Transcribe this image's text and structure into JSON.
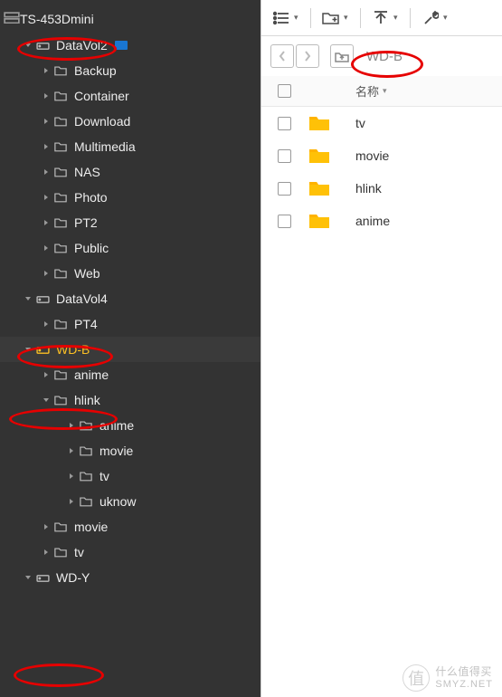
{
  "root": {
    "label": "TS-453Dmini"
  },
  "tree": [
    {
      "type": "drive",
      "label": "DataVol2",
      "depth": 1,
      "expanded": true,
      "selected": false,
      "badge": true
    },
    {
      "type": "folder",
      "label": "Backup",
      "depth": 2,
      "expanded": false
    },
    {
      "type": "folder",
      "label": "Container",
      "depth": 2,
      "expanded": false
    },
    {
      "type": "folder",
      "label": "Download",
      "depth": 2,
      "expanded": false
    },
    {
      "type": "folder",
      "label": "Multimedia",
      "depth": 2,
      "expanded": false
    },
    {
      "type": "folder",
      "label": "NAS",
      "depth": 2,
      "expanded": false
    },
    {
      "type": "folder",
      "label": "Photo",
      "depth": 2,
      "expanded": false
    },
    {
      "type": "folder",
      "label": "PT2",
      "depth": 2,
      "expanded": false
    },
    {
      "type": "folder",
      "label": "Public",
      "depth": 2,
      "expanded": false
    },
    {
      "type": "folder",
      "label": "Web",
      "depth": 2,
      "expanded": false
    },
    {
      "type": "drive",
      "label": "DataVol4",
      "depth": 1,
      "expanded": true,
      "selected": false
    },
    {
      "type": "folder",
      "label": "PT4",
      "depth": 2,
      "expanded": false
    },
    {
      "type": "drive",
      "label": "WD-B",
      "depth": 1,
      "expanded": true,
      "selected": true
    },
    {
      "type": "folder",
      "label": "anime",
      "depth": 2,
      "expanded": false
    },
    {
      "type": "folder",
      "label": "hlink",
      "depth": 2,
      "expanded": true
    },
    {
      "type": "folder",
      "label": "anime",
      "depth": 3,
      "expanded": false
    },
    {
      "type": "folder",
      "label": "movie",
      "depth": 3,
      "expanded": false
    },
    {
      "type": "folder",
      "label": "tv",
      "depth": 3,
      "expanded": false
    },
    {
      "type": "folder",
      "label": "uknow",
      "depth": 3,
      "expanded": false
    },
    {
      "type": "folder",
      "label": "movie",
      "depth": 2,
      "expanded": false
    },
    {
      "type": "folder",
      "label": "tv",
      "depth": 2,
      "expanded": false
    },
    {
      "type": "drive",
      "label": "WD-Y",
      "depth": 1,
      "expanded": true,
      "selected": false
    }
  ],
  "breadcrumb": "WD-B",
  "columns": {
    "name": "名称"
  },
  "files": [
    {
      "name": "tv"
    },
    {
      "name": "movie"
    },
    {
      "name": "hlink"
    },
    {
      "name": "anime"
    }
  ],
  "watermark": {
    "badge": "值",
    "text": "什么值得买",
    "site": "SMYZ.NET"
  },
  "toolbar": {
    "view": "list-view",
    "new": "new-folder",
    "upload": "upload",
    "tools": "tools"
  }
}
